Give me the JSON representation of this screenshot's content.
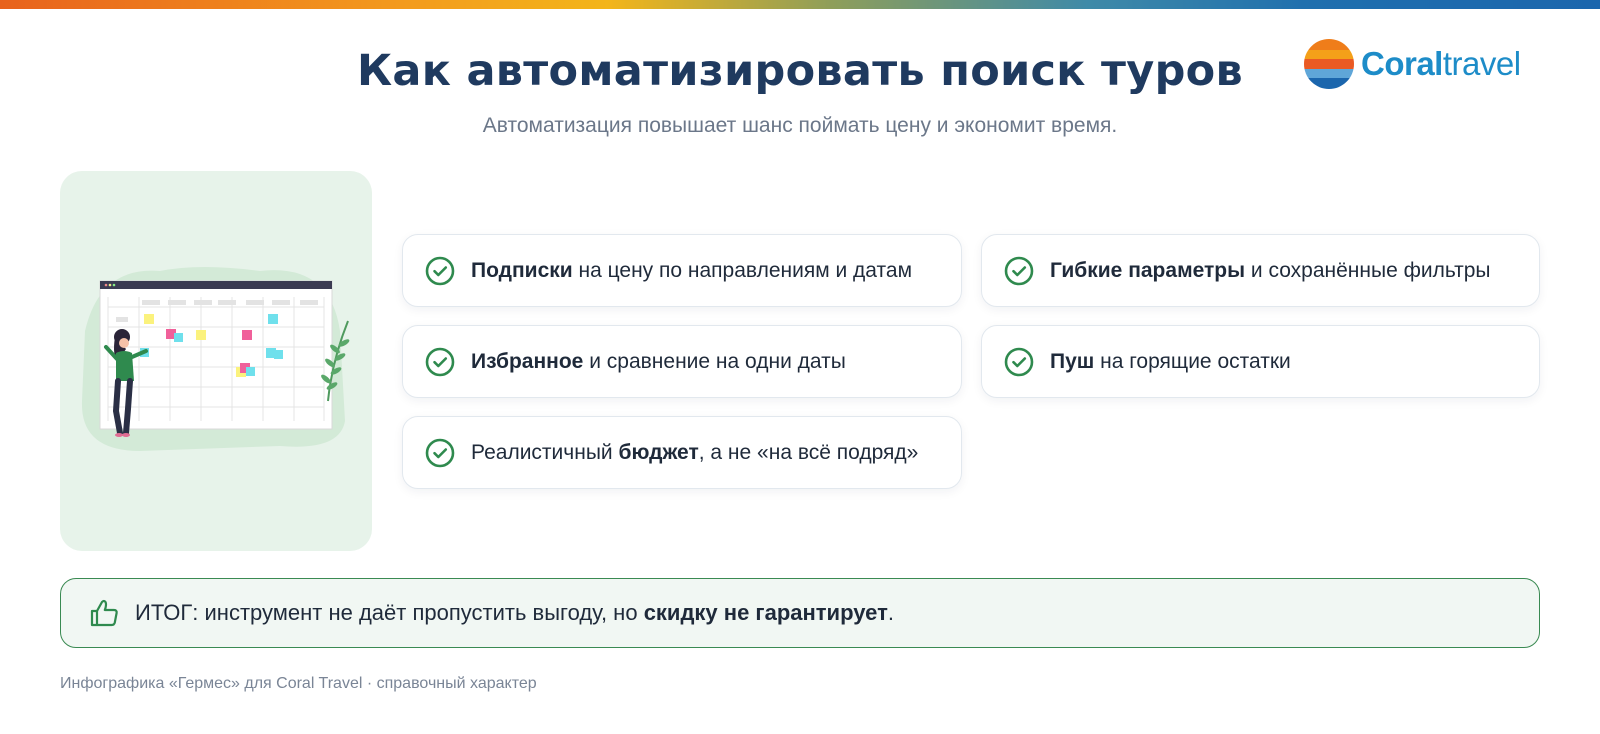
{
  "header": {
    "title": "Как автоматизировать поиск туров",
    "subtitle": "Автоматизация повышает шанс поймать цену и экономит время."
  },
  "logo": {
    "text_bold": "Coral",
    "text_light": "travel",
    "color": "#1d8cc8"
  },
  "features": [
    {
      "bold": "Подписки",
      "rest": " на цену по направлениям и датам",
      "icon": "check-circle-icon"
    },
    {
      "bold": "Гибкие параметры",
      "rest": " и сохранённые фильтры",
      "icon": "check-circle-icon"
    },
    {
      "bold": "Избранное",
      "rest": " и сравнение на одни даты",
      "icon": "check-circle-icon"
    },
    {
      "bold": "Пуш",
      "rest": " на горящие остатки",
      "icon": "check-circle-icon"
    },
    {
      "pre": "Реалистичный ",
      "bold": "бюджет",
      "rest": ", а не «на всё подряд»",
      "icon": "check-circle-icon"
    }
  ],
  "summary": {
    "pre": "ИТОГ: инструмент не даёт пропустить выгоду, но ",
    "bold": "скидку не гарантирует",
    "post": ".",
    "icon": "thumbs-up-icon"
  },
  "footer": {
    "text": "Инфографика «Гермес» для Coral Travel · справочный характер"
  },
  "colors": {
    "title": "#1f3a5f",
    "accent_green": "#2f8a4e",
    "panel_green": "#e7f3ea",
    "summary_bg": "#f1f7f3"
  }
}
